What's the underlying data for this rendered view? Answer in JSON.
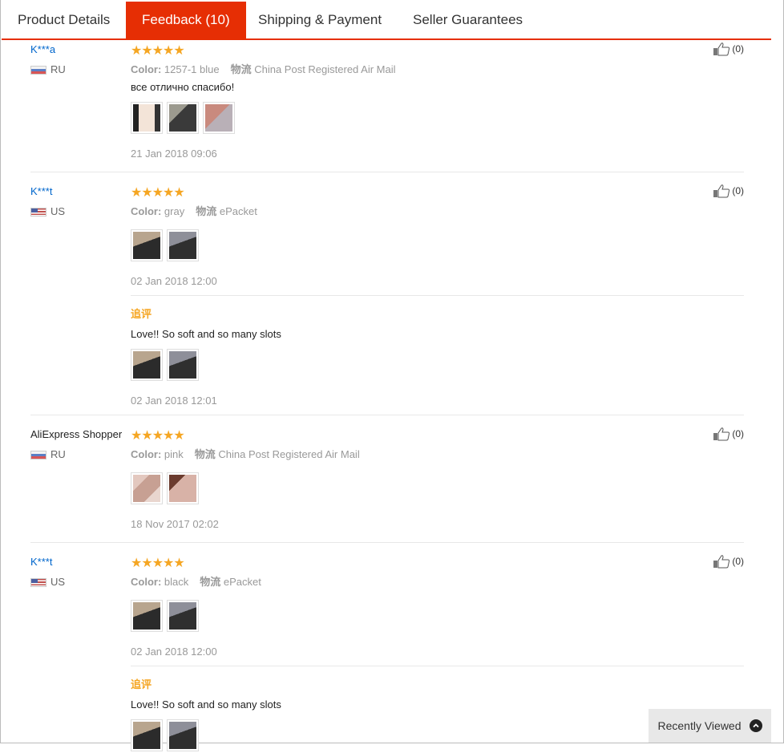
{
  "tabs": [
    {
      "label": "Product Details"
    },
    {
      "label": "Feedback (10)"
    },
    {
      "label": "Shipping & Payment"
    },
    {
      "label": "Seller Guarantees"
    }
  ],
  "reviews": [
    {
      "name": "K***a",
      "country": "RU",
      "stars": "★★★★★",
      "color_label": "Color:",
      "color_value": "1257-1 blue",
      "logistics_label": "物流",
      "logistics_value": "China Post Registered Air Mail",
      "text": "все отлично спасибо!",
      "photos": [
        "photo-1",
        "photo-2",
        "photo-3"
      ],
      "date": "21 Jan 2018 09:06",
      "useful": "(0)"
    },
    {
      "name": "K***t",
      "country": "US",
      "stars": "★★★★★",
      "color_label": "Color:",
      "color_value": "gray",
      "logistics_label": "物流",
      "logistics_value": "ePacket",
      "photos": [
        "photo-1",
        "photo-2"
      ],
      "date": "02 Jan 2018 12:00",
      "additional": {
        "label": "追评",
        "text": "Love!! So soft and so many slots",
        "date": "02 Jan 2018 12:01"
      },
      "useful": "(0)"
    },
    {
      "name": "AliExpress Shopper",
      "country": "RU",
      "stars": "★★★★★",
      "color_label": "Color:",
      "color_value": "pink",
      "logistics_label": "物流",
      "logistics_value": "China Post Registered Air Mail",
      "photos": [
        "photo-1",
        "photo-2"
      ],
      "date": "18 Nov 2017 02:02",
      "useful": "(0)"
    },
    {
      "name": "K***t",
      "country": "US",
      "stars": "★★★★★",
      "color_label": "Color:",
      "color_value": "black",
      "logistics_label": "物流",
      "logistics_value": "ePacket",
      "photos": [
        "photo-1",
        "photo-2"
      ],
      "date": "02 Jan 2018 12:00",
      "additional": {
        "label": "追评",
        "text": "Love!! So soft and so many slots"
      },
      "useful": "(0)"
    }
  ],
  "recently_viewed": {
    "label": "Recently Viewed",
    "icon": "chevron-up-icon"
  },
  "colors": {
    "accent": "#e62e04",
    "star": "#f5a623",
    "link": "#0066cc"
  }
}
